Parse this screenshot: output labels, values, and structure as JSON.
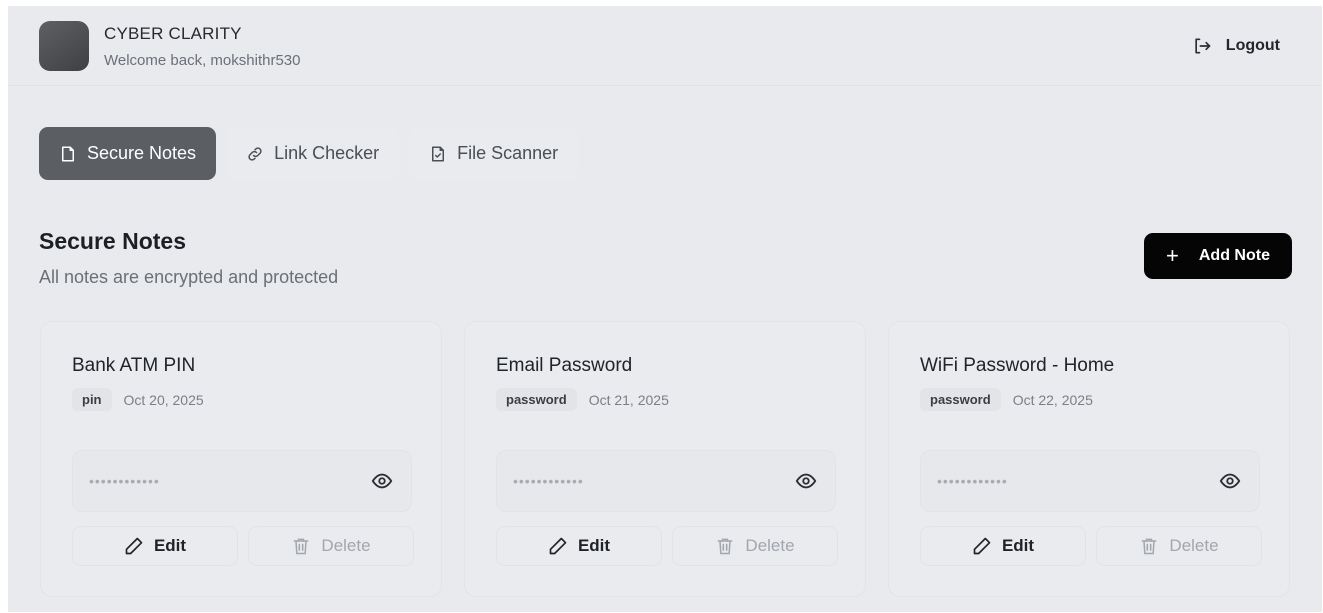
{
  "header": {
    "brand": "CYBER CLARITY",
    "welcome": "Welcome back, mokshithr530",
    "logout_label": "Logout"
  },
  "tabs": [
    {
      "label": "Secure Notes",
      "icon": "note-icon",
      "active": true
    },
    {
      "label": "Link Checker",
      "icon": "link-icon",
      "active": false
    },
    {
      "label": "File Scanner",
      "icon": "file-check-icon",
      "active": false
    }
  ],
  "section": {
    "title": "Secure Notes",
    "subtitle": "All notes are encrypted and protected",
    "add_label": "Add Note",
    "add_icon": "+"
  },
  "notes": [
    {
      "title": "Bank ATM PIN",
      "tag": "pin",
      "date": "Oct 20, 2025",
      "masked": "••••••••••••",
      "edit_label": "Edit",
      "delete_label": "Delete"
    },
    {
      "title": "Email Password",
      "tag": "password",
      "date": "Oct 21, 2025",
      "masked": "••••••••••••",
      "edit_label": "Edit",
      "delete_label": "Delete"
    },
    {
      "title": "WiFi Password - Home",
      "tag": "password",
      "date": "Oct 22, 2025",
      "masked": "••••••••••••",
      "edit_label": "Edit",
      "delete_label": "Delete"
    }
  ],
  "colors": {
    "background": "#e8eaee",
    "active_tab": "#5b5f64",
    "primary_button": "#050505",
    "muted_text": "#6b7078"
  }
}
